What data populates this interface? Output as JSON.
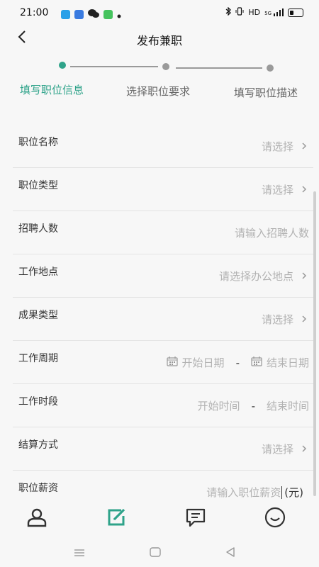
{
  "status_bar": {
    "time": "21:00",
    "network": "HD",
    "signal": "5G",
    "battery_level": 0.35,
    "icons": [
      "bluetooth-icon",
      "vibrate-icon",
      "signal-icon",
      "battery-icon"
    ],
    "app_icons": [
      "app-blue-icon",
      "app-blue2-icon",
      "wechat-icon",
      "app-green-icon",
      "dot-icon"
    ]
  },
  "nav": {
    "title": "发布兼职",
    "back_icon": "chevron-left-icon"
  },
  "stepper": {
    "steps": [
      {
        "label": "填写职位信息",
        "active": true
      },
      {
        "label": "选择职位要求",
        "active": false
      },
      {
        "label": "填写职位描述",
        "active": false
      }
    ],
    "active_color": "#2fa38a",
    "inactive_color": "#9a9a9a"
  },
  "form": {
    "rows": [
      {
        "label": "职位名称",
        "value": "请选择",
        "arrow": true
      },
      {
        "label": "职位类型",
        "value": "请选择",
        "arrow": true
      },
      {
        "label": "招聘人数",
        "value": "请输入招聘人数",
        "arrow": false
      },
      {
        "label": "工作地点",
        "value": "请选择办公地点",
        "arrow": true
      },
      {
        "label": "成果类型",
        "value": "请选择",
        "arrow": true
      }
    ],
    "period": {
      "label": "工作周期",
      "start": "开始日期",
      "separator": "-",
      "end": "结束日期"
    },
    "hours": {
      "label": "工作时段",
      "start": "开始时间",
      "separator": "-",
      "end": "结束时间"
    },
    "settlement": {
      "label": "结算方式",
      "value": "请选择",
      "arrow": true
    },
    "salary": {
      "label": "职位薪资",
      "placeholder": "请输入职位薪资",
      "unit": "(元)"
    }
  },
  "tab_bar": {
    "tabs": [
      "person-icon",
      "edit-icon",
      "message-icon",
      "smile-icon"
    ],
    "active_index": 1,
    "active_color": "#2fa38a"
  },
  "system_nav": [
    "menu-icon",
    "home-icon",
    "back-icon"
  ]
}
